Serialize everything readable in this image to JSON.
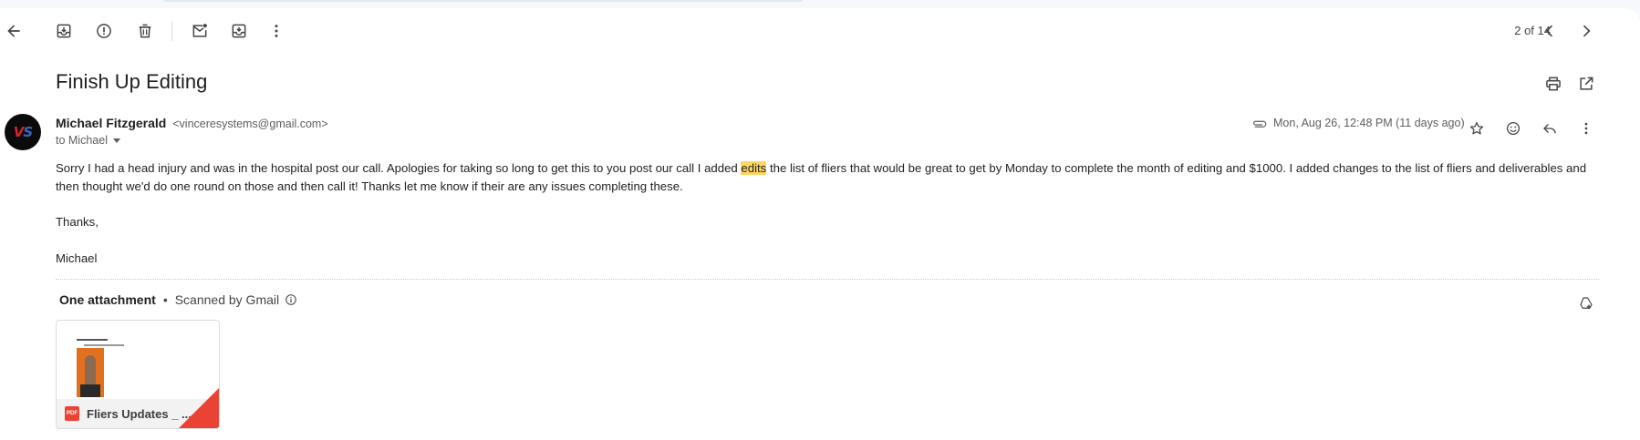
{
  "toolbar": {
    "back": "arrow-back-icon",
    "archive": "archive-icon",
    "report_spam": "report-spam-icon",
    "delete": "trash-icon",
    "mark_unread": "mark-unread-icon",
    "move_to": "move-to-inbox-icon",
    "more": "more-vert-icon"
  },
  "pager": {
    "text": "2 of 14",
    "newer": "chevron-left-icon",
    "older": "chevron-right-icon"
  },
  "subject": "Finish Up Editing",
  "header_actions": {
    "print": "print-icon",
    "open_new_window": "open-in-new-icon"
  },
  "message": {
    "sender_name": "Michael Fitzgerald",
    "sender_email": "<vinceresystems@gmail.com>",
    "recipients": "to Michael",
    "date": "Mon, Aug 26, 12:48 PM (11 days ago)",
    "body": {
      "p1_before": "Sorry I had a head injury and was in the hospital post our call. Apologies for taking so long to get this to you post our call I added ",
      "p1_highlight": "edits",
      "p1_after": " the list of fliers that would be great to get by Monday to complete the month of editing and $1000. I added changes to the list of fliers and deliverables and then thought we'd do one round on those and then call it! Thanks let me know if their are any issues completing these.",
      "p2": "Thanks,",
      "p3": "Michael"
    }
  },
  "attachments": {
    "title": "One attachment",
    "separator": "•",
    "scan_note": "Scanned by Gmail",
    "files": [
      {
        "badge": "PDF",
        "name": "Fliers Updates _ ..."
      }
    ]
  },
  "colors": {
    "highlight": "#fdd663",
    "pdf_red": "#ea4335",
    "page_bg": "#f6f8fc"
  }
}
